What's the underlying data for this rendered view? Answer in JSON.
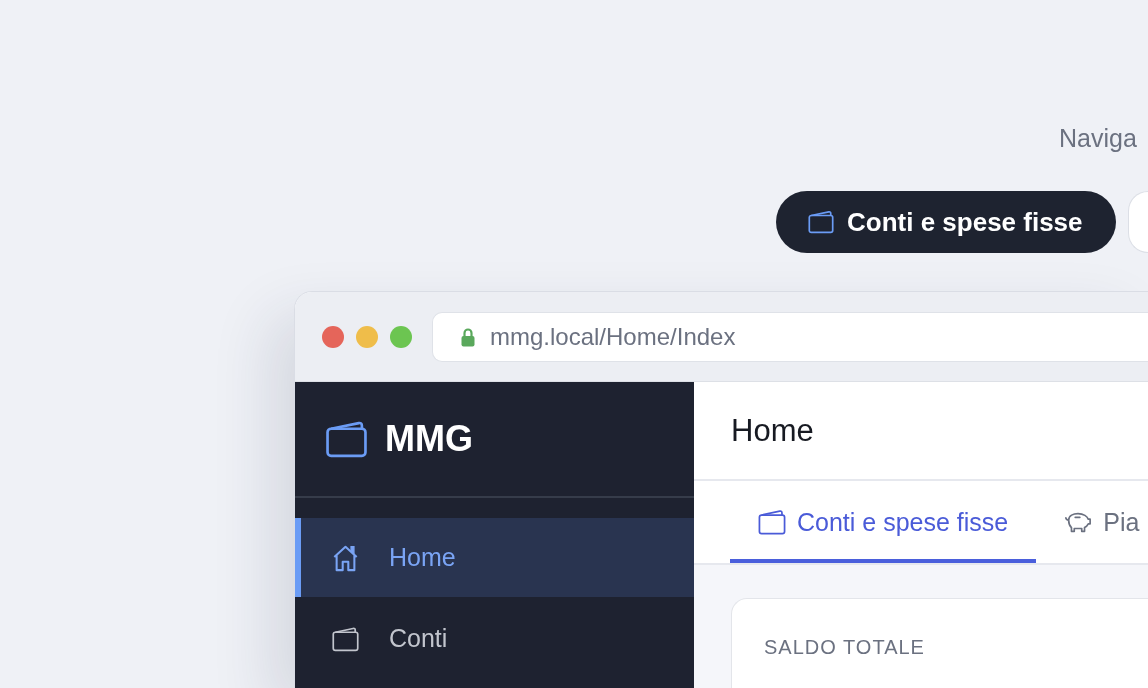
{
  "intro": {
    "text": "Naviga"
  },
  "nav_buttons": [
    {
      "label": "Conti e spese fisse",
      "kind": "wallet",
      "selected": true
    },
    {
      "selected": false
    }
  ],
  "browser": {
    "url": "mmg.local/Home/Index"
  },
  "sidebar": {
    "brand": "MMG",
    "items": [
      {
        "label": "Home",
        "kind": "home",
        "selected": true
      },
      {
        "label": "Conti",
        "kind": "wallet",
        "selected": false
      }
    ]
  },
  "page": {
    "title": "Home"
  },
  "tabs": [
    {
      "label": "Conti e spese fisse",
      "kind": "wallet",
      "selected": true
    },
    {
      "label": "Pia",
      "kind": "savings",
      "selected": false
    }
  ],
  "summary_card": {
    "label": "SALDO TOTALE"
  }
}
